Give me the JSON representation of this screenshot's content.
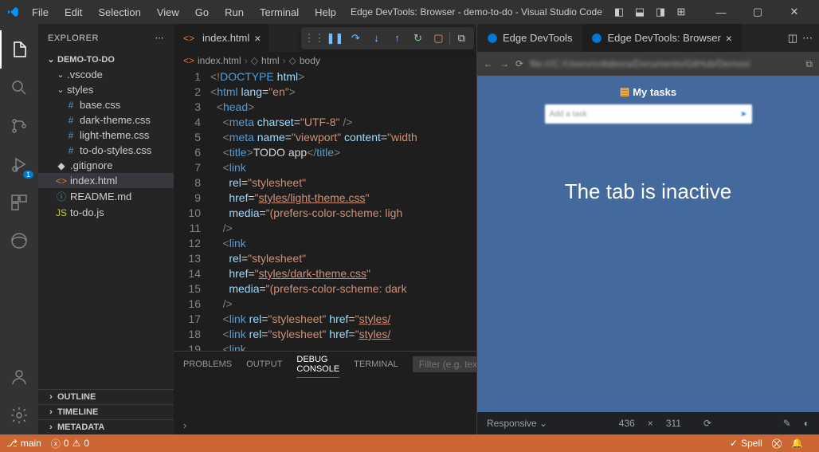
{
  "titlebar": {
    "menus": [
      "File",
      "Edit",
      "Selection",
      "View",
      "Go",
      "Run",
      "Terminal",
      "Help"
    ],
    "title": "Edge DevTools: Browser - demo-to-do - Visual Studio Code"
  },
  "sidebar": {
    "title": "EXPLORER",
    "root": "DEMO-TO-DO",
    "folders": {
      "vscode": ".vscode",
      "styles": "styles"
    },
    "files": {
      "base_css": "base.css",
      "dark_theme_css": "dark-theme.css",
      "light_theme_css": "light-theme.css",
      "todo_styles_css": "to-do-styles.css",
      "gitignore": ".gitignore",
      "index_html": "index.html",
      "readme_md": "README.md",
      "todo_js": "to-do.js"
    },
    "sections": {
      "outline": "OUTLINE",
      "timeline": "TIMELINE",
      "metadata": "METADATA"
    }
  },
  "editor": {
    "tab_label": "index.html",
    "breadcrumbs": [
      "index.html",
      "html",
      "body"
    ],
    "lines": [
      {
        "n": "1",
        "tokens": [
          {
            "t": "<!",
            "c": "bracket"
          },
          {
            "t": "DOCTYPE",
            "c": "tag"
          },
          {
            "t": " ",
            "c": "text"
          },
          {
            "t": "html",
            "c": "attr"
          },
          {
            "t": ">",
            "c": "bracket"
          }
        ]
      },
      {
        "n": "2",
        "tokens": [
          {
            "t": "<",
            "c": "bracket"
          },
          {
            "t": "html",
            "c": "tag"
          },
          {
            "t": " ",
            "c": "text"
          },
          {
            "t": "lang",
            "c": "attr"
          },
          {
            "t": "=",
            "c": "text"
          },
          {
            "t": "\"en\"",
            "c": "str"
          },
          {
            "t": ">",
            "c": "bracket"
          }
        ]
      },
      {
        "n": "3",
        "tokens": [
          {
            "t": "  ",
            "c": "text"
          },
          {
            "t": "<",
            "c": "bracket"
          },
          {
            "t": "head",
            "c": "tag"
          },
          {
            "t": ">",
            "c": "bracket"
          }
        ]
      },
      {
        "n": "4",
        "tokens": [
          {
            "t": "    ",
            "c": "text"
          },
          {
            "t": "<",
            "c": "bracket"
          },
          {
            "t": "meta",
            "c": "tag"
          },
          {
            "t": " ",
            "c": "text"
          },
          {
            "t": "charset",
            "c": "attr"
          },
          {
            "t": "=",
            "c": "text"
          },
          {
            "t": "\"UTF-8\"",
            "c": "str"
          },
          {
            "t": " />",
            "c": "bracket"
          }
        ]
      },
      {
        "n": "5",
        "tokens": [
          {
            "t": "    ",
            "c": "text"
          },
          {
            "t": "<",
            "c": "bracket"
          },
          {
            "t": "meta",
            "c": "tag"
          },
          {
            "t": " ",
            "c": "text"
          },
          {
            "t": "name",
            "c": "attr"
          },
          {
            "t": "=",
            "c": "text"
          },
          {
            "t": "\"viewport\"",
            "c": "str"
          },
          {
            "t": " ",
            "c": "text"
          },
          {
            "t": "content",
            "c": "attr"
          },
          {
            "t": "=",
            "c": "text"
          },
          {
            "t": "\"width",
            "c": "str"
          }
        ]
      },
      {
        "n": "6",
        "tokens": [
          {
            "t": "    ",
            "c": "text"
          },
          {
            "t": "<",
            "c": "bracket"
          },
          {
            "t": "title",
            "c": "tag"
          },
          {
            "t": ">",
            "c": "bracket"
          },
          {
            "t": "TODO app",
            "c": "text"
          },
          {
            "t": "</",
            "c": "bracket"
          },
          {
            "t": "title",
            "c": "tag"
          },
          {
            "t": ">",
            "c": "bracket"
          }
        ]
      },
      {
        "n": "7",
        "tokens": [
          {
            "t": "    ",
            "c": "text"
          },
          {
            "t": "<",
            "c": "bracket"
          },
          {
            "t": "link",
            "c": "tag"
          }
        ]
      },
      {
        "n": "8",
        "tokens": [
          {
            "t": "      ",
            "c": "text"
          },
          {
            "t": "rel",
            "c": "attr"
          },
          {
            "t": "=",
            "c": "text"
          },
          {
            "t": "\"stylesheet\"",
            "c": "str"
          }
        ]
      },
      {
        "n": "9",
        "tokens": [
          {
            "t": "      ",
            "c": "text"
          },
          {
            "t": "href",
            "c": "attr"
          },
          {
            "t": "=",
            "c": "text"
          },
          {
            "t": "\"",
            "c": "str"
          },
          {
            "t": "styles/light-theme.css",
            "c": "link"
          },
          {
            "t": "\"",
            "c": "str"
          }
        ]
      },
      {
        "n": "10",
        "tokens": [
          {
            "t": "      ",
            "c": "text"
          },
          {
            "t": "media",
            "c": "attr"
          },
          {
            "t": "=",
            "c": "text"
          },
          {
            "t": "\"(prefers-color-scheme: ligh",
            "c": "str"
          }
        ]
      },
      {
        "n": "11",
        "tokens": [
          {
            "t": "    ",
            "c": "text"
          },
          {
            "t": "/>",
            "c": "bracket"
          }
        ]
      },
      {
        "n": "12",
        "tokens": [
          {
            "t": "    ",
            "c": "text"
          },
          {
            "t": "<",
            "c": "bracket"
          },
          {
            "t": "link",
            "c": "tag"
          }
        ]
      },
      {
        "n": "13",
        "tokens": [
          {
            "t": "      ",
            "c": "text"
          },
          {
            "t": "rel",
            "c": "attr"
          },
          {
            "t": "=",
            "c": "text"
          },
          {
            "t": "\"stylesheet\"",
            "c": "str"
          }
        ]
      },
      {
        "n": "14",
        "tokens": [
          {
            "t": "      ",
            "c": "text"
          },
          {
            "t": "href",
            "c": "attr"
          },
          {
            "t": "=",
            "c": "text"
          },
          {
            "t": "\"",
            "c": "str"
          },
          {
            "t": "styles/dark-theme.css",
            "c": "link"
          },
          {
            "t": "\"",
            "c": "str"
          }
        ]
      },
      {
        "n": "15",
        "tokens": [
          {
            "t": "      ",
            "c": "text"
          },
          {
            "t": "media",
            "c": "attr"
          },
          {
            "t": "=",
            "c": "text"
          },
          {
            "t": "\"(prefers-color-scheme: dark",
            "c": "str"
          }
        ]
      },
      {
        "n": "16",
        "tokens": [
          {
            "t": "    ",
            "c": "text"
          },
          {
            "t": "/>",
            "c": "bracket"
          }
        ]
      },
      {
        "n": "17",
        "tokens": [
          {
            "t": "    ",
            "c": "text"
          },
          {
            "t": "<",
            "c": "bracket"
          },
          {
            "t": "link",
            "c": "tag"
          },
          {
            "t": " ",
            "c": "text"
          },
          {
            "t": "rel",
            "c": "attr"
          },
          {
            "t": "=",
            "c": "text"
          },
          {
            "t": "\"stylesheet\"",
            "c": "str"
          },
          {
            "t": " ",
            "c": "text"
          },
          {
            "t": "href",
            "c": "attr"
          },
          {
            "t": "=",
            "c": "text"
          },
          {
            "t": "\"",
            "c": "str"
          },
          {
            "t": "styles/",
            "c": "link"
          }
        ]
      },
      {
        "n": "18",
        "tokens": [
          {
            "t": "    ",
            "c": "text"
          },
          {
            "t": "<",
            "c": "bracket"
          },
          {
            "t": "link",
            "c": "tag"
          },
          {
            "t": " ",
            "c": "text"
          },
          {
            "t": "rel",
            "c": "attr"
          },
          {
            "t": "=",
            "c": "text"
          },
          {
            "t": "\"stylesheet\"",
            "c": "str"
          },
          {
            "t": " ",
            "c": "text"
          },
          {
            "t": "href",
            "c": "attr"
          },
          {
            "t": "=",
            "c": "text"
          },
          {
            "t": "\"",
            "c": "str"
          },
          {
            "t": "styles/",
            "c": "link"
          }
        ]
      },
      {
        "n": "19",
        "tokens": [
          {
            "t": "    ",
            "c": "text"
          },
          {
            "t": "<",
            "c": "bracket"
          },
          {
            "t": "link",
            "c": "tag"
          }
        ]
      }
    ]
  },
  "panels": {
    "tabs": {
      "problems": "PROBLEMS",
      "output": "OUTPUT",
      "debug": "DEBUG CONSOLE",
      "terminal": "TERMINAL"
    },
    "filter_placeholder": "Filter (e.g. text, !exclude)",
    "prompt": "›"
  },
  "devtools": {
    "tab1": "Edge DevTools",
    "tab2": "Edge DevTools: Browser",
    "url_blur": "file:///C:/Users/collabora/Documents/GitHub/Demos/",
    "page_title": "My tasks",
    "input_blur": "Add a task",
    "overlay": "The tab is inactive",
    "responsive": "Responsive",
    "w": "436",
    "h": "311"
  },
  "statusbar": {
    "branch": "main",
    "errors": "0",
    "warnings": "0",
    "spell": "Spell"
  },
  "activity_badge": "1"
}
